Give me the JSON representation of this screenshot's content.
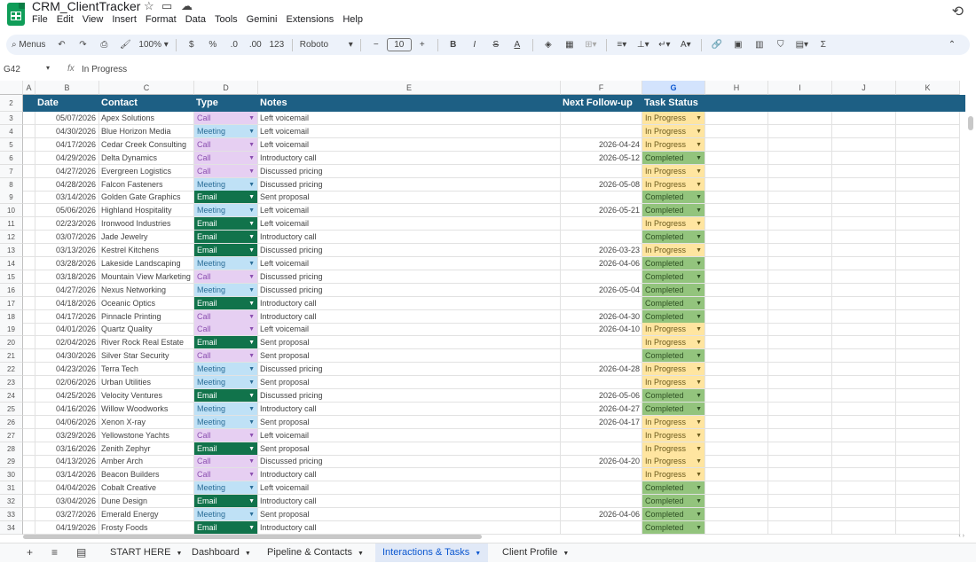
{
  "app": {
    "title": "CRM_ClientTracker",
    "menu": [
      "File",
      "Edit",
      "View",
      "Insert",
      "Format",
      "Data",
      "Tools",
      "Gemini",
      "Extensions",
      "Help"
    ]
  },
  "toolbar": {
    "menus_label": "Menus",
    "zoom": "100%",
    "currency": "$",
    "percent": "%",
    "dec_decrease": ".0",
    "dec_increase": ".00",
    "number_format": "123",
    "font": "Roboto",
    "font_size": "10"
  },
  "formula_bar": {
    "cell_ref": "G42",
    "fx": "fx",
    "value": "In Progress"
  },
  "columns": [
    "A",
    "B",
    "C",
    "D",
    "E",
    "F",
    "G",
    "H",
    "I",
    "J",
    "K"
  ],
  "header": {
    "row_num": "2",
    "date": "Date",
    "contact": "Contact",
    "type": "Type",
    "notes": "Notes",
    "followup": "Next Follow-up",
    "status": "Task Status"
  },
  "rows": [
    {
      "n": "3",
      "date": "05/07/2026",
      "contact": "Apex Solutions",
      "type": "Call",
      "notes": "Left voicemail",
      "fu": "",
      "status": "In Progress"
    },
    {
      "n": "4",
      "date": "04/30/2026",
      "contact": "Blue Horizon Media",
      "type": "Meeting",
      "notes": "Left voicemail",
      "fu": "",
      "status": "In Progress"
    },
    {
      "n": "5",
      "date": "04/17/2026",
      "contact": "Cedar Creek Consulting",
      "type": "Call",
      "notes": "Left voicemail",
      "fu": "2026-04-24",
      "status": "In Progress"
    },
    {
      "n": "6",
      "date": "04/29/2026",
      "contact": "Delta Dynamics",
      "type": "Call",
      "notes": "Introductory call",
      "fu": "2026-05-12",
      "status": "Completed"
    },
    {
      "n": "7",
      "date": "04/27/2026",
      "contact": "Evergreen Logistics",
      "type": "Call",
      "notes": "Discussed pricing",
      "fu": "",
      "status": "In Progress"
    },
    {
      "n": "8",
      "date": "04/28/2026",
      "contact": "Falcon Fasteners",
      "type": "Meeting",
      "notes": "Discussed pricing",
      "fu": "2026-05-08",
      "status": "In Progress"
    },
    {
      "n": "9",
      "date": "03/14/2026",
      "contact": "Golden Gate Graphics",
      "type": "Email",
      "notes": "Sent proposal",
      "fu": "",
      "status": "Completed"
    },
    {
      "n": "10",
      "date": "05/06/2026",
      "contact": "Highland Hospitality",
      "type": "Meeting",
      "notes": "Left voicemail",
      "fu": "2026-05-21",
      "status": "Completed"
    },
    {
      "n": "11",
      "date": "02/23/2026",
      "contact": "Ironwood Industries",
      "type": "Email",
      "notes": "Left voicemail",
      "fu": "",
      "status": "In Progress"
    },
    {
      "n": "12",
      "date": "03/07/2026",
      "contact": "Jade Jewelry",
      "type": "Email",
      "notes": "Introductory call",
      "fu": "",
      "status": "Completed"
    },
    {
      "n": "13",
      "date": "03/13/2026",
      "contact": "Kestrel Kitchens",
      "type": "Email",
      "notes": "Discussed pricing",
      "fu": "2026-03-23",
      "status": "In Progress"
    },
    {
      "n": "14",
      "date": "03/28/2026",
      "contact": "Lakeside Landscaping",
      "type": "Meeting",
      "notes": "Left voicemail",
      "fu": "2026-04-06",
      "status": "Completed"
    },
    {
      "n": "15",
      "date": "03/18/2026",
      "contact": "Mountain View Marketing",
      "type": "Call",
      "notes": "Discussed pricing",
      "fu": "",
      "status": "Completed"
    },
    {
      "n": "16",
      "date": "04/27/2026",
      "contact": "Nexus Networking",
      "type": "Meeting",
      "notes": "Discussed pricing",
      "fu": "2026-05-04",
      "status": "Completed"
    },
    {
      "n": "17",
      "date": "04/18/2026",
      "contact": "Oceanic Optics",
      "type": "Email",
      "notes": "Introductory call",
      "fu": "",
      "status": "Completed"
    },
    {
      "n": "18",
      "date": "04/17/2026",
      "contact": "Pinnacle Printing",
      "type": "Call",
      "notes": "Introductory call",
      "fu": "2026-04-30",
      "status": "Completed"
    },
    {
      "n": "19",
      "date": "04/01/2026",
      "contact": "Quartz Quality",
      "type": "Call",
      "notes": "Left voicemail",
      "fu": "2026-04-10",
      "status": "In Progress"
    },
    {
      "n": "20",
      "date": "02/04/2026",
      "contact": "River Rock Real Estate",
      "type": "Email",
      "notes": "Sent proposal",
      "fu": "",
      "status": "In Progress"
    },
    {
      "n": "21",
      "date": "04/30/2026",
      "contact": "Silver Star Security",
      "type": "Call",
      "notes": "Sent proposal",
      "fu": "",
      "status": "Completed"
    },
    {
      "n": "22",
      "date": "04/23/2026",
      "contact": "Terra Tech",
      "type": "Meeting",
      "notes": "Discussed pricing",
      "fu": "2026-04-28",
      "status": "In Progress"
    },
    {
      "n": "23",
      "date": "02/06/2026",
      "contact": "Urban Utilities",
      "type": "Meeting",
      "notes": "Sent proposal",
      "fu": "",
      "status": "In Progress"
    },
    {
      "n": "24",
      "date": "04/25/2026",
      "contact": "Velocity Ventures",
      "type": "Email",
      "notes": "Discussed pricing",
      "fu": "2026-05-06",
      "status": "Completed"
    },
    {
      "n": "25",
      "date": "04/16/2026",
      "contact": "Willow Woodworks",
      "type": "Meeting",
      "notes": "Introductory call",
      "fu": "2026-04-27",
      "status": "Completed"
    },
    {
      "n": "26",
      "date": "04/06/2026",
      "contact": "Xenon X-ray",
      "type": "Meeting",
      "notes": "Sent proposal",
      "fu": "2026-04-17",
      "status": "In Progress"
    },
    {
      "n": "27",
      "date": "03/29/2026",
      "contact": "Yellowstone Yachts",
      "type": "Call",
      "notes": "Left voicemail",
      "fu": "",
      "status": "In Progress"
    },
    {
      "n": "28",
      "date": "03/16/2026",
      "contact": "Zenith Zephyr",
      "type": "Email",
      "notes": "Sent proposal",
      "fu": "",
      "status": "In Progress"
    },
    {
      "n": "29",
      "date": "04/13/2026",
      "contact": "Amber Arch",
      "type": "Call",
      "notes": "Discussed pricing",
      "fu": "2026-04-20",
      "status": "In Progress"
    },
    {
      "n": "30",
      "date": "03/14/2026",
      "contact": "Beacon Builders",
      "type": "Call",
      "notes": "Introductory call",
      "fu": "",
      "status": "In Progress"
    },
    {
      "n": "31",
      "date": "04/04/2026",
      "contact": "Cobalt Creative",
      "type": "Meeting",
      "notes": "Left voicemail",
      "fu": "",
      "status": "Completed"
    },
    {
      "n": "32",
      "date": "03/04/2026",
      "contact": "Dune Design",
      "type": "Email",
      "notes": "Introductory call",
      "fu": "",
      "status": "Completed"
    },
    {
      "n": "33",
      "date": "03/27/2026",
      "contact": "Emerald Energy",
      "type": "Meeting",
      "notes": "Sent proposal",
      "fu": "2026-04-06",
      "status": "Completed"
    },
    {
      "n": "34",
      "date": "04/19/2026",
      "contact": "Frosty Foods",
      "type": "Email",
      "notes": "Introductory call",
      "fu": "",
      "status": "Completed"
    }
  ],
  "sheets": [
    {
      "label": "START HERE",
      "active": false
    },
    {
      "label": "Dashboard",
      "active": false
    },
    {
      "label": "Pipeline & Contacts",
      "active": false
    },
    {
      "label": "Interactions & Tasks",
      "active": true
    },
    {
      "label": "Client Profile",
      "active": false
    }
  ],
  "colors": {
    "header_bg": "#1d5f84",
    "call": "#e6cff2",
    "meeting": "#bfe1f6",
    "email": "#11734b",
    "in_progress": "#ffe5a0",
    "completed": "#93c47d",
    "active_tab": "#0b57d0"
  }
}
